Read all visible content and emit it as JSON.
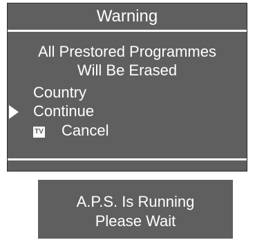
{
  "dialog": {
    "title": "Warning",
    "message_line1": "All Prestored Programmes",
    "message_line2": "Will Be Erased",
    "menu": {
      "country": "Country",
      "continue": "Continue",
      "cancel": "Cancel",
      "cancel_icon": "TV",
      "selected": "Continue"
    }
  },
  "status": {
    "line1": "A.P.S. Is Running",
    "line2": "Please Wait"
  },
  "colors": {
    "panel": "#5f5f5f",
    "text": "#ffffff"
  },
  "icons": {
    "selector": "triangle-pointer-icon",
    "cancel_key": "tv-key-icon"
  }
}
